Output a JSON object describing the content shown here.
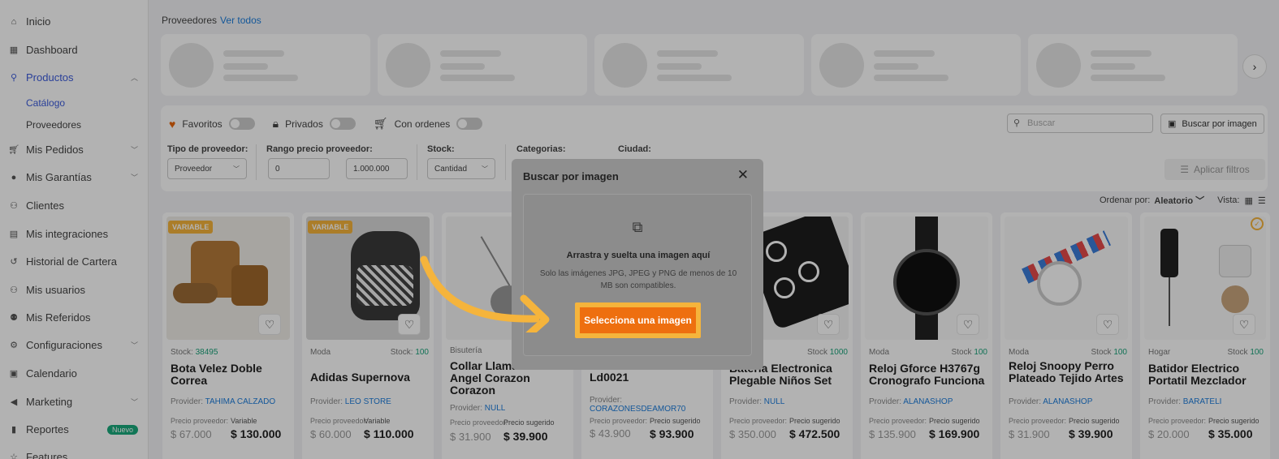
{
  "sidebar": {
    "items": [
      {
        "label": "Inicio",
        "icon": "home-icon"
      },
      {
        "label": "Dashboard",
        "icon": "dashboard-icon"
      },
      {
        "label": "Productos",
        "icon": "search-icon"
      },
      {
        "label": "Mis Pedidos",
        "icon": "cart-icon"
      },
      {
        "label": "Mis Garantías",
        "icon": "shield-icon"
      },
      {
        "label": "Clientes",
        "icon": "users-icon"
      },
      {
        "label": "Mis integraciones",
        "icon": "store-icon"
      },
      {
        "label": "Historial de Cartera",
        "icon": "history-icon"
      },
      {
        "label": "Mis usuarios",
        "icon": "user-group-icon"
      },
      {
        "label": "Mis Referidos",
        "icon": "referral-icon"
      },
      {
        "label": "Configuraciones",
        "icon": "gear-icon"
      },
      {
        "label": "Calendario",
        "icon": "calendar-icon"
      },
      {
        "label": "Marketing",
        "icon": "megaphone-icon"
      },
      {
        "label": "Reportes",
        "icon": "chart-icon"
      }
    ],
    "sub_items": [
      "Catálogo",
      "Proveedores"
    ],
    "new_badge": "Nuevo",
    "cut_item": "Features"
  },
  "providers": {
    "title": "Proveedores",
    "view_all": "Ver todos"
  },
  "filters": {
    "toggles": [
      {
        "label": "Favoritos",
        "icon": "heart-icon"
      },
      {
        "label": "Privados",
        "icon": "lock-icon"
      },
      {
        "label": "Con ordenes",
        "icon": "cart-icon"
      }
    ],
    "search_placeholder": "Buscar",
    "search_image_label": "Buscar por imagen",
    "provider_type_label": "Tipo de proveedor:",
    "provider_type_value": "Proveedor",
    "price_range_label": "Rango precio proveedor:",
    "price_min": "0",
    "price_max": "1.000.000",
    "stock_label": "Stock:",
    "stock_value": "Cantidad",
    "categories_label": "Categorias:",
    "city_label": "Ciudad:",
    "apply_label": "Aplicar filtros"
  },
  "sort": {
    "label": "Ordenar por:",
    "value": "Aleatorio",
    "view_label": "Vista:"
  },
  "products": [
    {
      "tag": "VARIABLE",
      "category": "",
      "stock_label": "Stock:",
      "stock": "38495",
      "name": "Bota Velez Doble Correa",
      "provider": "TAHIMA CALZADO",
      "price_label": "Precio proveedor:",
      "price_label2": "Variable",
      "price": "$ 67.000",
      "suggested": "$ 130.000"
    },
    {
      "tag": "VARIABLE",
      "category": "Moda",
      "stock_label": "Stock:",
      "stock": "100",
      "name": "Adidas Supernova",
      "provider": "LEO STORE",
      "price_label": "Precio proveedor:",
      "price_label2": "Variable",
      "price": "$ 60.000",
      "suggested": "$ 110.000"
    },
    {
      "tag": "",
      "category": "Bisutería",
      "stock_label": "",
      "stock": "",
      "name": "Collar Llamador De Angel Corazon Corazon",
      "provider": "NULL",
      "price_label": "Precio proveedor:",
      "price_label2": "Precio sugerido",
      "price": "$ 31.900",
      "suggested": "$ 39.900"
    },
    {
      "tag": "",
      "category": "",
      "stock_label": "",
      "stock": "",
      "name": "Ld0021",
      "provider": "CORAZONESDEAMOR70",
      "price_label": "Precio proveedor:",
      "price_label2": "Precio sugerido",
      "price": "$ 43.900",
      "suggested": "$ 93.900"
    },
    {
      "tag": "",
      "category": "",
      "stock_label": "Stock",
      "stock": "1000",
      "name": "Bateria Electronica Plegable Niños Set",
      "provider": "NULL",
      "price_label": "Precio proveedor:",
      "price_label2": "Precio sugerido",
      "price": "$ 350.000",
      "suggested": "$ 472.500"
    },
    {
      "tag": "",
      "category": "Moda",
      "stock_label": "Stock",
      "stock": "100",
      "name": "Reloj Gforce H3767g Cronografo Funciona",
      "provider": "ALANASHOP",
      "price_label": "Precio proveedor:",
      "price_label2": "Precio sugerido",
      "price": "$ 135.900",
      "suggested": "$ 169.900"
    },
    {
      "tag": "",
      "category": "Moda",
      "stock_label": "Stock",
      "stock": "100",
      "name": "Reloj Snoopy Perro Plateado Tejido Artes",
      "provider": "ALANASHOP",
      "price_label": "Precio proveedor:",
      "price_label2": "Precio sugerido",
      "price": "$ 31.900",
      "suggested": "$ 39.900"
    },
    {
      "tag": "",
      "category": "Hogar",
      "stock_label": "Stock",
      "stock": "100",
      "name": "Batidor Electrico Portatil Mezclador",
      "provider": "BARATELI",
      "price_label": "Precio proveedor:",
      "price_label2": "Precio sugerido",
      "price": "$ 20.000",
      "suggested": "$ 35.000"
    }
  ],
  "provider_prefix": "Provider:",
  "modal": {
    "title": "Buscar por imagen",
    "drop_title": "Arrastra y suelta una imagen aquí",
    "drop_sub": "Solo las imágenes JPG, JPEG y PNG de menos de 10 MB son compatibles.",
    "select_label": "Selecciona una imagen"
  },
  "colors": {
    "accent": "#ee6f0f",
    "highlight": "#f5b43c",
    "link": "#1d7ddb",
    "stock_green": "#1aa37a"
  }
}
